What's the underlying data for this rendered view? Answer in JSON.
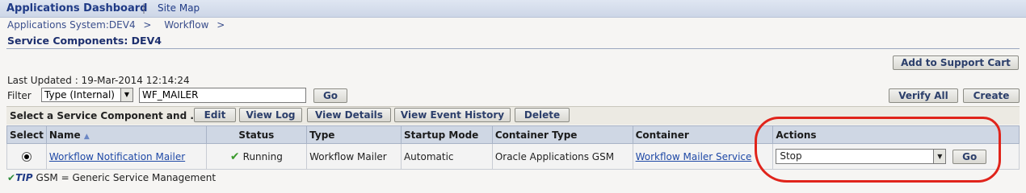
{
  "nav": {
    "home": "Applications Dashboard",
    "separator": "|",
    "site_map": "Site Map"
  },
  "breadcrumbs": [
    {
      "label": "Applications System:DEV4",
      "sep": ">"
    },
    {
      "label": "Workflow",
      "sep": ">"
    }
  ],
  "page_title": "Service Components: DEV4",
  "buttons": {
    "add_to_cart": "Add to Support Cart",
    "verify_all": "Verify All",
    "create": "Create",
    "filter_go": "Go",
    "edit": "Edit",
    "view_log": "View Log",
    "view_details": "View Details",
    "view_event_history": "View Event History",
    "delete": "Delete"
  },
  "last_updated": "Last Updated : 19-Mar-2014 12:14:24",
  "filter": {
    "label": "Filter",
    "type_selected": "Type (Internal)",
    "value": "WF_MAILER"
  },
  "toolbar_label": "Select a Service Component and ...",
  "table": {
    "headers": {
      "select": "Select",
      "name": "Name",
      "sort_indicator": "▲",
      "status": "Status",
      "type": "Type",
      "startup_mode": "Startup Mode",
      "container_type": "Container Type",
      "container": "Container",
      "actions": "Actions"
    },
    "rows": [
      {
        "name": "Workflow Notification Mailer",
        "status_icon": "checkmark-icon",
        "status": "Running",
        "type": "Workflow Mailer",
        "startup_mode": "Automatic",
        "container_type": "Oracle Applications GSM",
        "container": "Workflow Mailer Service",
        "action_selected": "Stop",
        "action_go": "Go"
      }
    ]
  },
  "tip": {
    "icon": "✔",
    "word": "TIP",
    "text": "GSM = Generic Service Management"
  },
  "colors": {
    "nav_bg": "#cdd6e7",
    "link": "#1f49a6",
    "header_bg": "#cfd7e4",
    "annotation": "#e0241b",
    "running": "#3a9a2c"
  }
}
